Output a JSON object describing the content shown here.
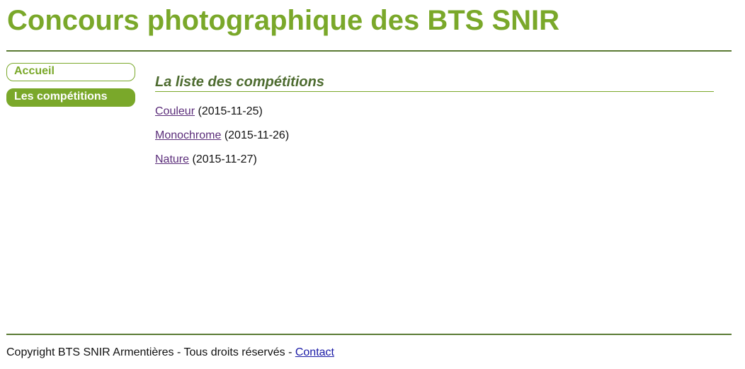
{
  "header": {
    "title": "Concours photographique des BTS SNIR"
  },
  "nav": {
    "items": [
      {
        "label": "Accueil",
        "active": false
      },
      {
        "label": "Les compétitions",
        "active": true
      }
    ]
  },
  "main": {
    "section_title": "La liste des compétitions",
    "competitions": [
      {
        "name": "Couleur",
        "date": "(2015-11-25)"
      },
      {
        "name": "Monochrome",
        "date": "(2015-11-26)"
      },
      {
        "name": "Nature",
        "date": "(2015-11-27)"
      }
    ]
  },
  "footer": {
    "text": "Copyright BTS SNIR Armentières - Tous droits réservés - ",
    "contact_label": "Contact"
  },
  "colors": {
    "accent": "#7aa82a",
    "rule": "#5a7a33",
    "heading": "#4d6b2f",
    "visited_link": "#5b2d7a",
    "link": "#1a1aa6"
  }
}
